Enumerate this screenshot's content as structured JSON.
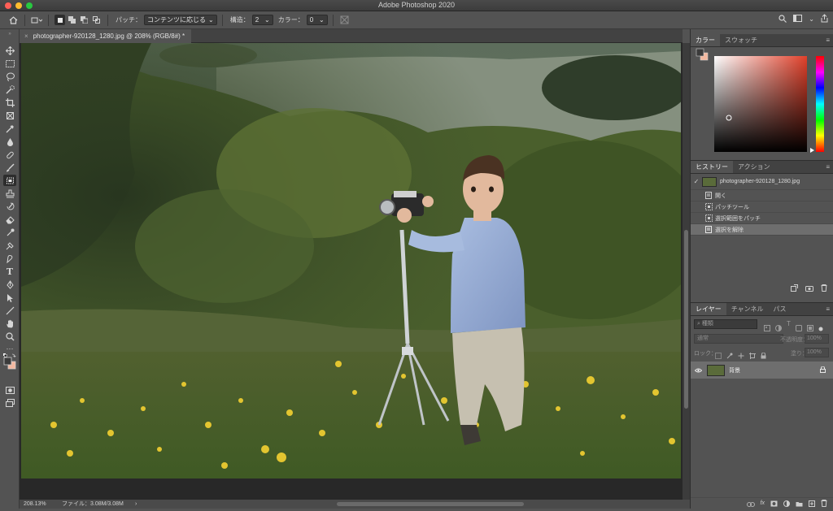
{
  "window": {
    "title": "Adobe Photoshop 2020"
  },
  "options_bar": {
    "patch_label": "パッチ：",
    "patch_value": "コンテンツに応じる",
    "structure_label": "構造：",
    "structure_value": "2",
    "color_label": "カラー：",
    "color_value": "0"
  },
  "document": {
    "tab_title": "photographer-920128_1280.jpg @ 208% (RGB/8#) *",
    "close_glyph": "×"
  },
  "status": {
    "zoom": "208.13%",
    "file_info": "ファイル：3.08M/3.08M",
    "arrow": "›"
  },
  "color_panel": {
    "tabs": [
      "カラー",
      "スウォッチ"
    ],
    "foreground": "#3b3b3b",
    "background": "#f2b8a0",
    "hue_accent": "#e0402a"
  },
  "history_panel": {
    "tabs": [
      "ヒストリー",
      "アクション"
    ],
    "snapshot_label": "photographer-920128_1280.jpg",
    "items": [
      "開く",
      "パッチツール",
      "選択範囲をパッチ",
      "選択を解除"
    ]
  },
  "layers_panel": {
    "tabs": [
      "レイヤー",
      "チャンネル",
      "パス"
    ],
    "filter_label": "種類",
    "blend_mode": "通常",
    "opacity_label": "不透明度：",
    "opacity_value": "100%",
    "lock_label": "ロック：",
    "fill_label": "塗り：",
    "fill_value": "100%",
    "layers": [
      {
        "name": "背景"
      }
    ],
    "bottom_icons": [
      "link-icon",
      "fx-icon",
      "mask-icon",
      "adjustment-icon",
      "group-icon",
      "new-layer-icon",
      "trash-icon"
    ]
  },
  "panel_menu_glyph": "≡",
  "ui": {
    "tool_icons": [
      "move-icon",
      "marquee-icon",
      "lasso-icon",
      "quick-select-icon",
      "crop-icon",
      "frame-icon",
      "eyedropper-icon",
      "spot-heal-icon",
      "brush-icon",
      "patch-icon",
      "clone-stamp-icon",
      "history-brush-icon",
      "eraser-icon",
      "gradient-icon",
      "blur-icon",
      "dodge-icon",
      "pen-icon",
      "type-icon",
      "path-select-icon",
      "line-icon",
      "hand-icon",
      "zoom-icon",
      "more-tools-icon"
    ]
  }
}
